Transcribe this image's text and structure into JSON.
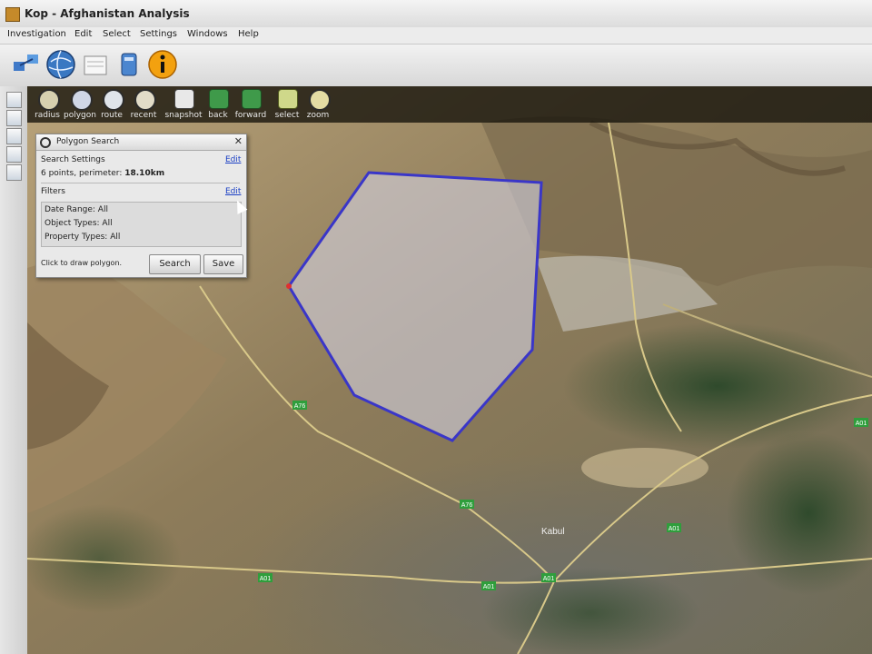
{
  "window": {
    "title": "Kop - Afghanistan Analysis",
    "icon": "app-icon"
  },
  "menu": [
    "Investigation",
    "Edit",
    "Select",
    "Settings",
    "Windows",
    "Help"
  ],
  "main_toolbar": [
    "graph-icon",
    "globe-icon",
    "document-icon",
    "database-icon",
    "info-icon"
  ],
  "side_strip": [
    "panel-icon",
    "panel-icon",
    "panel-icon",
    "panel-icon",
    "panel-icon"
  ],
  "map_toolbar": [
    {
      "label": "radius",
      "icon": "radius-icon"
    },
    {
      "label": "polygon",
      "icon": "polygon-icon"
    },
    {
      "label": "route",
      "icon": "route-icon"
    },
    {
      "label": "recent",
      "icon": "recent-icon"
    },
    {
      "label": "snapshot",
      "icon": "camera-icon"
    },
    {
      "label": "back",
      "icon": "back-icon"
    },
    {
      "label": "forward",
      "icon": "forward-icon"
    },
    {
      "label": "select",
      "icon": "select-icon"
    },
    {
      "label": "zoom",
      "icon": "zoom-icon"
    }
  ],
  "polygon_panel": {
    "title": "Polygon Search",
    "search_settings_label": "Search Settings",
    "edit_label": "Edit",
    "summary_prefix": "6 points, perimeter:",
    "summary_value": "18.10km",
    "filters_label": "Filters",
    "filters": [
      "Date Range: All",
      "Object Types: All",
      "Property Types: All"
    ],
    "hint": "Click to draw polygon.",
    "search_button": "Search",
    "save_button": "Save"
  },
  "map": {
    "city_label": "Kabul",
    "road_badges": [
      "A76",
      "A76",
      "A01",
      "A01",
      "A01",
      "A01",
      "A01"
    ],
    "polygon_color": "#3a36c8",
    "road_badge_color": "#2f9e3c"
  }
}
